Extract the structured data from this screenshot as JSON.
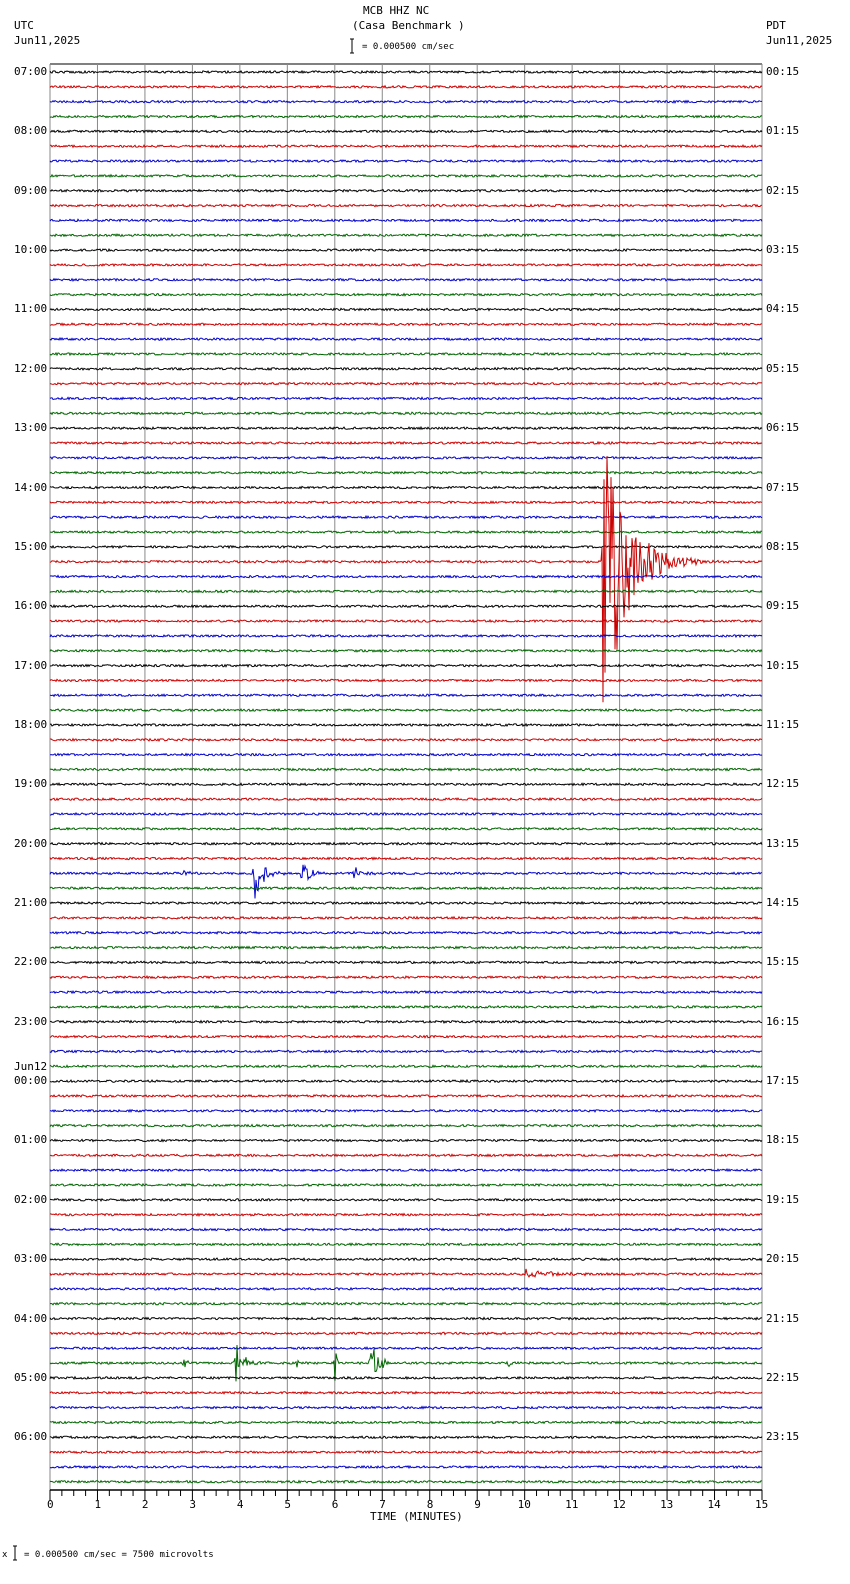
{
  "header": {
    "station": "MCB HHZ NC",
    "location": "(Casa Benchmark )",
    "left_tz": "UTC",
    "left_date": "Jun11,2025",
    "right_tz": "PDT",
    "right_date": "Jun11,2025",
    "scale_text": "= 0.000500 cm/sec"
  },
  "footer": {
    "scale_text": "= 0.000500 cm/sec =    7500 microvolts",
    "marker": "x"
  },
  "chart_data": {
    "type": "line",
    "title": "MCB HHZ NC (Casa Benchmark )",
    "xlabel": "TIME (MINUTES)",
    "xlim": [
      0,
      15
    ],
    "xticks": [
      "0",
      "1",
      "2",
      "3",
      "4",
      "5",
      "6",
      "7",
      "8",
      "9",
      "10",
      "11",
      "12",
      "13",
      "14",
      "15"
    ],
    "rows_per_hour": 4,
    "row_count": 96,
    "trace_colors": [
      "#000000",
      "#cc0000",
      "#0000cc",
      "#006600"
    ],
    "left_labels": [
      "07:00",
      "08:00",
      "09:00",
      "10:00",
      "11:00",
      "12:00",
      "13:00",
      "14:00",
      "15:00",
      "16:00",
      "17:00",
      "18:00",
      "19:00",
      "20:00",
      "21:00",
      "22:00",
      "23:00",
      "00:00",
      "01:00",
      "02:00",
      "03:00",
      "04:00",
      "05:00",
      "06:00"
    ],
    "date_change_label": "Jun12",
    "date_change_index": 17,
    "right_labels": [
      "00:15",
      "01:15",
      "02:15",
      "03:15",
      "04:15",
      "05:15",
      "06:15",
      "07:15",
      "08:15",
      "09:15",
      "10:15",
      "11:15",
      "12:15",
      "13:15",
      "14:15",
      "15:15",
      "16:15",
      "17:15",
      "18:15",
      "19:15",
      "20:15",
      "21:15",
      "22:15",
      "23:15"
    ],
    "events": [
      {
        "row": 33,
        "minute": 11.65,
        "amplitude_traces": 12,
        "coda_min": 1.0
      },
      {
        "row": 54,
        "minute": 4.3,
        "amplitude_traces": 2.0,
        "coda_min": 0.4
      },
      {
        "row": 54,
        "minute": 5.3,
        "amplitude_traces": 0.9,
        "coda_min": 0.4
      },
      {
        "row": 54,
        "minute": 6.4,
        "amplitude_traces": 0.5,
        "coda_min": 0.3
      },
      {
        "row": 54,
        "minute": 2.8,
        "amplitude_traces": 0.3,
        "coda_min": 0.2
      },
      {
        "row": 87,
        "minute": 3.9,
        "amplitude_traces": 2.0,
        "coda_min": 0.3
      },
      {
        "row": 87,
        "minute": 6.75,
        "amplitude_traces": 1.6,
        "coda_min": 0.35
      },
      {
        "row": 87,
        "minute": 6.0,
        "amplitude_traces": 1.4,
        "coda_min": 0.1
      },
      {
        "row": 87,
        "minute": 2.8,
        "amplitude_traces": 0.4,
        "coda_min": 0.2
      },
      {
        "row": 87,
        "minute": 5.2,
        "amplitude_traces": 0.5,
        "coda_min": 0.1
      },
      {
        "row": 87,
        "minute": 9.6,
        "amplitude_traces": 0.4,
        "coda_min": 0.3
      },
      {
        "row": 81,
        "minute": 10.0,
        "amplitude_traces": 0.3,
        "coda_min": 1.2
      }
    ]
  }
}
